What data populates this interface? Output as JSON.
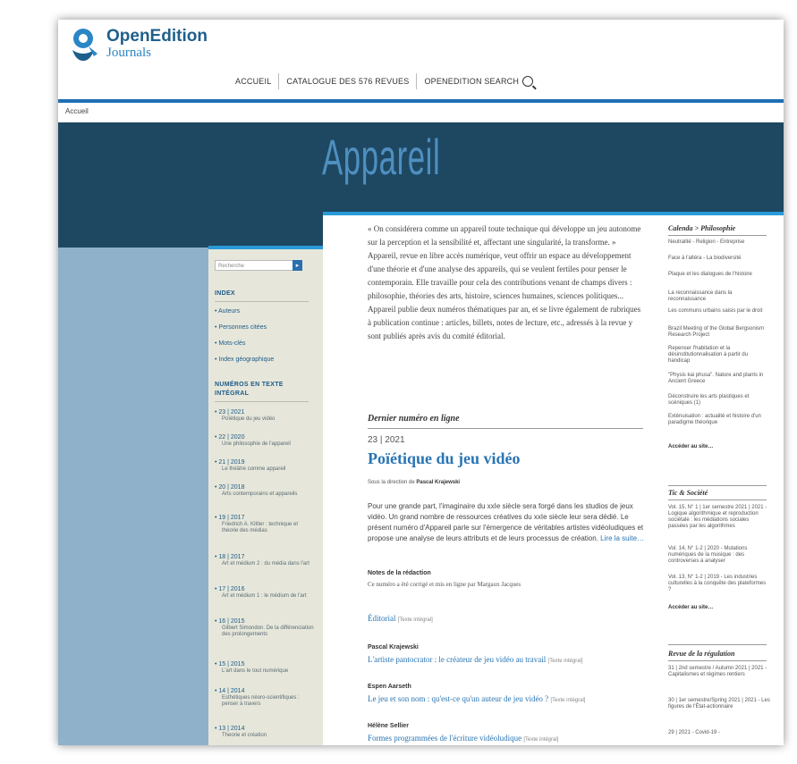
{
  "header": {
    "logo_title": "OpenEdition",
    "logo_subtitle": "Journals",
    "nav": [
      "ACCUEIL",
      "CATALOGUE DES 576 REVUES",
      "OPENEDITION SEARCH"
    ]
  },
  "breadcrumb": "Accueil",
  "banner_title": "Appareil",
  "sidebar": {
    "search_placeholder": "Recherche",
    "search_button": "▸",
    "index_head": "INDEX",
    "index_links": [
      "• Auteurs",
      "• Personnes citées",
      "• Mots-clés",
      "• Index géographique"
    ],
    "numbers_head_1": "NUMÉROS EN TEXTE",
    "numbers_head_2": "INTÉGRAL",
    "issues": [
      {
        "num": "• 23 | 2021",
        "title": "Poïétique du jeu vidéo"
      },
      {
        "num": "• 22 | 2020",
        "title": "Une philosophie de l'appareil"
      },
      {
        "num": "• 21 | 2019",
        "title": "Le théâtre comme appareil"
      },
      {
        "num": "• 20 | 2018",
        "title": "Arts contemporains et appareils"
      },
      {
        "num": "• 19 | 2017",
        "title": "Friedrich A. Kittler : technique et théorie des médias"
      },
      {
        "num": "• 18 | 2017",
        "title": "Art et médium 2 : du média dans l'art"
      },
      {
        "num": "• 17 | 2016",
        "title": "Art et médium 1 : le médium de l'art"
      },
      {
        "num": "• 16 | 2015",
        "title": "Gilbert Simondon. De la différenciation des prolongements"
      },
      {
        "num": "• 15 | 2015",
        "title": "L'art dans le tout numérique"
      },
      {
        "num": "• 14 | 2014",
        "title": "Esthétiques néoro-scientifiques : penser à travers"
      },
      {
        "num": "• 13 | 2014",
        "title": "Theorie et création"
      }
    ]
  },
  "content": {
    "intro_p1": "« On considérera comme un appareil toute technique qui développe un jeu autonome sur la perception et la sensibilité et, affectant une singularité, la transforme. » Appareil, revue en libre accès numérique, veut offrir un espace au développement d'une théorie et d'une analyse des appareils, qui se veulent fertiles pour penser le contemporain. Elle travaille pour cela des contributions venant de champs divers : philosophie, théories des arts, histoire, sciences humaines, sciences politiques...",
    "intro_p2": "Appareil publie deux numéros thématiques par an, et se livre également de rubriques à publication continue : articles, billets, notes de lecture, etc., adressés à la revue y sont publiés après avis du comité éditorial.",
    "last_issue_head": "Dernier numéro en ligne",
    "issue_id": "23 | 2021",
    "issue_title": "Poïétique du jeu vidéo",
    "direction_label": "Sous la direction de",
    "direction_name": "Pascal Krajewski",
    "abstract": "Pour une grande part, l'imaginaire du xxIe siècle sera forgé dans les studios de jeux vidéo. Un grand nombre de ressources créatives du xxIe siècle leur sera dédié. Le présent numéro d'Appareil parle sur l'émergence de véritables artistes vidéoludiques et propose une analyse de leurs attributs et de leurs processus de création.",
    "read_more": "Lire la suite…",
    "note_head": "Notes de la rédaction",
    "note_text": "Ce numéro a été corrigé et mis en ligne par Margaux Jacques",
    "toc": [
      {
        "author": "",
        "title": "Éditorial",
        "tag": "[Texte intégral]"
      },
      {
        "author": "Pascal Krajewski",
        "title": "L'artiste pantocrator : le créateur de jeu vidéo au travail",
        "tag": "[Texte intégral]"
      },
      {
        "author": "Espen Aarseth",
        "title": "Le jeu et son nom : qu'est-ce qu'un auteur de jeu vidéo ?",
        "tag": "[Texte intégral]"
      },
      {
        "author": "Hélène Sellier",
        "title": "Formes programmées de l'écriture vidéoludique",
        "tag": "[Texte intégral]"
      }
    ]
  },
  "right": {
    "calenda_head": "Calenda > Philosophie",
    "calenda_items": [
      "Neutralité - Religion - Entreprise",
      "Face à l'altéra - La biodiversité",
      "Plaque et les dialogues de l'histoire",
      "La reconnaissance dans la reconnaissance",
      "Les communs urbains saisis par le droit",
      "Brazil Meeting of the Global Bergsonism Research Project",
      "Repenser l'habitation et la désinstitutionnalisation à partir du handicap",
      "\"Physis kai phusa\". Nature and plants in Ancient Greece",
      "Déconstruire les arts plastiques et scéniques (1)",
      "Exténuisation : actualité et histoire d'un paradigme théorique"
    ],
    "more": "Accéder au site…",
    "soc_head": "Tic & Société",
    "soc_items": [
      "Vol. 15, N° 1 | 1er semestre 2021 | 2021 - Logique algorithmique et reproduction sociétale : les médiations sociales passées par les algorithmes",
      "Vol. 14, N° 1-2 | 2020 - Mutations numériques de la musique : des controverses à analyser",
      "Vol. 13, N° 1-2 | 2019 - Les industries culturelles à la conquête des plateformes ?"
    ],
    "reg_head": "Revue de la régulation",
    "reg_items": [
      "31 | 2nd semestre / Autumn 2021 | 2021 - Capitalismes et régimes rentiers",
      "30 | 1er semestre/Spring 2021 | 2021 - Les figures de l'État-actionnaire",
      "29 | 2021 - Covid-19 -"
    ]
  }
}
